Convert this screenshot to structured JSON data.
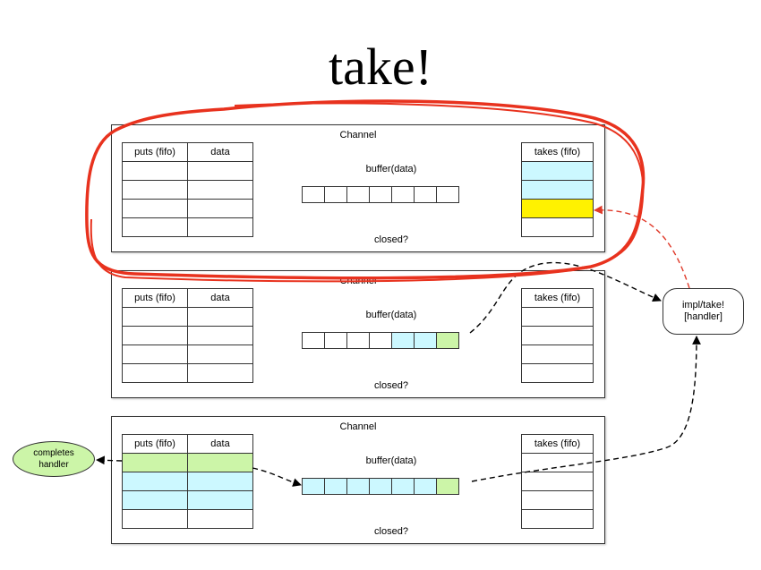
{
  "title": "take!",
  "channels": [
    {
      "label": "Channel",
      "puts_headers": [
        "puts (fifo)",
        "data"
      ],
      "puts_rows": [
        "empty",
        "empty",
        "empty",
        "empty"
      ],
      "takes_header": "takes (fifo)",
      "takes_rows": [
        "cyan",
        "cyan",
        "yellow",
        "empty"
      ],
      "buffer_label": "buffer(data)",
      "buffer_cells": [
        "empty",
        "empty",
        "empty",
        "empty",
        "empty",
        "empty",
        "empty"
      ],
      "closed_label": "closed?"
    },
    {
      "label": "Channel",
      "puts_headers": [
        "puts (fifo)",
        "data"
      ],
      "puts_rows": [
        "empty",
        "empty",
        "empty",
        "empty"
      ],
      "takes_header": "takes (fifo)",
      "takes_rows": [
        "empty",
        "empty",
        "empty",
        "empty"
      ],
      "buffer_label": "buffer(data)",
      "buffer_cells": [
        "empty",
        "empty",
        "empty",
        "empty",
        "cyan",
        "cyan",
        "green"
      ],
      "closed_label": "closed?"
    },
    {
      "label": "Channel",
      "puts_headers": [
        "puts (fifo)",
        "data"
      ],
      "puts_rows": [
        "green",
        "cyan",
        "cyan",
        "empty"
      ],
      "takes_header": "takes (fifo)",
      "takes_rows": [
        "empty",
        "empty",
        "empty",
        "empty"
      ],
      "buffer_label": "buffer(data)",
      "buffer_cells": [
        "cyan",
        "cyan",
        "cyan",
        "cyan",
        "cyan",
        "cyan",
        "green"
      ],
      "closed_label": "closed?"
    }
  ],
  "nodes": {
    "impl_line1": "impl/take!",
    "impl_line2": "[handler]",
    "completes_line1": "completes",
    "completes_line2": "handler"
  },
  "colors": {
    "cyan": "#ccf8ff",
    "green": "#ccf5a8",
    "yellow": "#fff200",
    "highlight": "#e8321e",
    "dashed_red": "#e03a2a"
  }
}
